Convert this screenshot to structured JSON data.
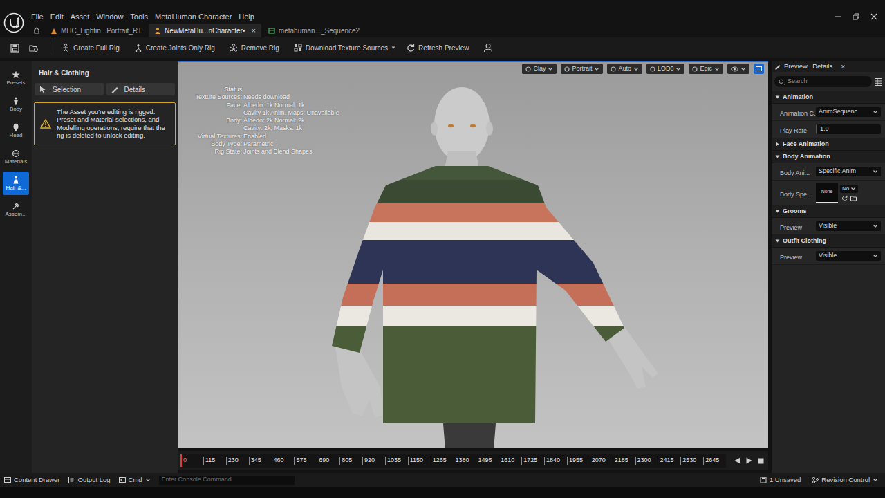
{
  "menu": [
    "File",
    "Edit",
    "Asset",
    "Window",
    "Tools",
    "MetaHuman Character",
    "Help"
  ],
  "tabs": [
    {
      "label": "MHC_Lightin...Portrait_RT",
      "selected": false
    },
    {
      "label": "NewMetaHu...nCharacter•",
      "selected": true
    },
    {
      "label": "metahuman..._Sequence2",
      "selected": false
    }
  ],
  "tab_close": "×",
  "toolbar": [
    {
      "label": "Create Full Rig",
      "dropdown": false
    },
    {
      "label": "Create Joints Only Rig",
      "dropdown": false
    },
    {
      "label": "Remove Rig",
      "dropdown": false
    },
    {
      "label": "Download Texture Sources",
      "dropdown": true
    },
    {
      "label": "Refresh Preview",
      "dropdown": false
    }
  ],
  "rail": [
    {
      "label": "Presets",
      "selected": false
    },
    {
      "label": "Body",
      "selected": false
    },
    {
      "label": "Head",
      "selected": false
    },
    {
      "label": "Materials",
      "selected": false
    },
    {
      "label": "Hair &...",
      "selected": true
    },
    {
      "label": "Assem...",
      "selected": false
    }
  ],
  "left_panel": {
    "title": "Hair & Clothing",
    "buttons": [
      "Selection",
      "Details"
    ],
    "warning": "The Asset you're editing is rigged. Preset and Material selections, and Modelling operations, require that the rig is deleted to unlock editing."
  },
  "viewport": {
    "toolbar": [
      "Clay",
      "Portrait",
      "Auto",
      "LOD0",
      "Epic"
    ],
    "status": {
      "title": "Status",
      "rows": [
        {
          "label": "Texture Sources:",
          "values": [
            "Needs download"
          ]
        },
        {
          "label": "Face:",
          "values": [
            "Albedo: 1k Normal: 1k",
            "Cavity 1k  Anim. Maps: Unavailable"
          ]
        },
        {
          "label": "Body:",
          "values": [
            "Albedo: 2k Normal: 2k",
            "Cavity: 2k, Masks: 1k"
          ]
        },
        {
          "label": "Virtual Textures:",
          "values": [
            "Enabled"
          ]
        },
        {
          "label": "Body Type:",
          "values": [
            "Parametric"
          ]
        },
        {
          "label": "Rig State:",
          "values": [
            "Joints and Blend Shapes"
          ]
        }
      ]
    }
  },
  "timeline": {
    "ticks": [
      {
        "label": "0",
        "current": true
      },
      {
        "label": "115",
        "current": false
      },
      {
        "label": "230",
        "current": false
      },
      {
        "label": "345",
        "current": false
      },
      {
        "label": "460",
        "current": false
      },
      {
        "label": "575",
        "current": false
      },
      {
        "label": "690",
        "current": false
      },
      {
        "label": "805",
        "current": false
      },
      {
        "label": "920",
        "current": false
      },
      {
        "label": "1035",
        "current": false
      },
      {
        "label": "1150",
        "current": false
      },
      {
        "label": "1265",
        "current": false
      },
      {
        "label": "1380",
        "current": false
      },
      {
        "label": "1495",
        "current": false
      },
      {
        "label": "1610",
        "current": false
      },
      {
        "label": "1725",
        "current": false
      },
      {
        "label": "1840",
        "current": false
      },
      {
        "label": "1955",
        "current": false
      },
      {
        "label": "2070",
        "current": false
      },
      {
        "label": "2185",
        "current": false
      },
      {
        "label": "2300",
        "current": false
      },
      {
        "label": "2415",
        "current": false
      },
      {
        "label": "2530",
        "current": false
      },
      {
        "label": "2645",
        "current": false
      }
    ]
  },
  "details": {
    "tab": "Preview...Details",
    "close": "×",
    "search": {
      "placeholder": "Search"
    },
    "sections": [
      {
        "title": "Animation",
        "expanded": true,
        "rows": [
          {
            "kind": "dropdown",
            "label": "Animation C...",
            "value": "AnimSequenc"
          },
          {
            "kind": "field",
            "label": "Play Rate",
            "value": "1.0"
          }
        ]
      },
      {
        "title": "Face Animation",
        "expanded": false,
        "rows": []
      },
      {
        "title": "Body Animation",
        "expanded": true,
        "rows": [
          {
            "kind": "dropdown",
            "label": "Body Ani...",
            "value": "Specific Anim"
          },
          {
            "kind": "asset",
            "label": "Body Spe...",
            "thumb": "None",
            "value": "No"
          }
        ]
      },
      {
        "title": "Grooms",
        "expanded": true,
        "rows": [
          {
            "kind": "dropdown",
            "label": "Preview",
            "value": "Visible"
          }
        ]
      },
      {
        "title": "Outfit Clothing",
        "expanded": true,
        "rows": [
          {
            "kind": "dropdown",
            "label": "Preview",
            "value": "Visible"
          }
        ]
      }
    ]
  },
  "status_bar": {
    "left": [
      {
        "label": "Content Drawer",
        "dropdown": false
      },
      {
        "label": "Output Log",
        "dropdown": false
      },
      {
        "label": "Cmd",
        "dropdown": true
      }
    ],
    "console": {
      "placeholder": "Enter Console Command"
    },
    "right": [
      {
        "label": "1 Unsaved",
        "dropdown": false
      },
      {
        "label": "Revision Control",
        "dropdown": true
      }
    ]
  }
}
